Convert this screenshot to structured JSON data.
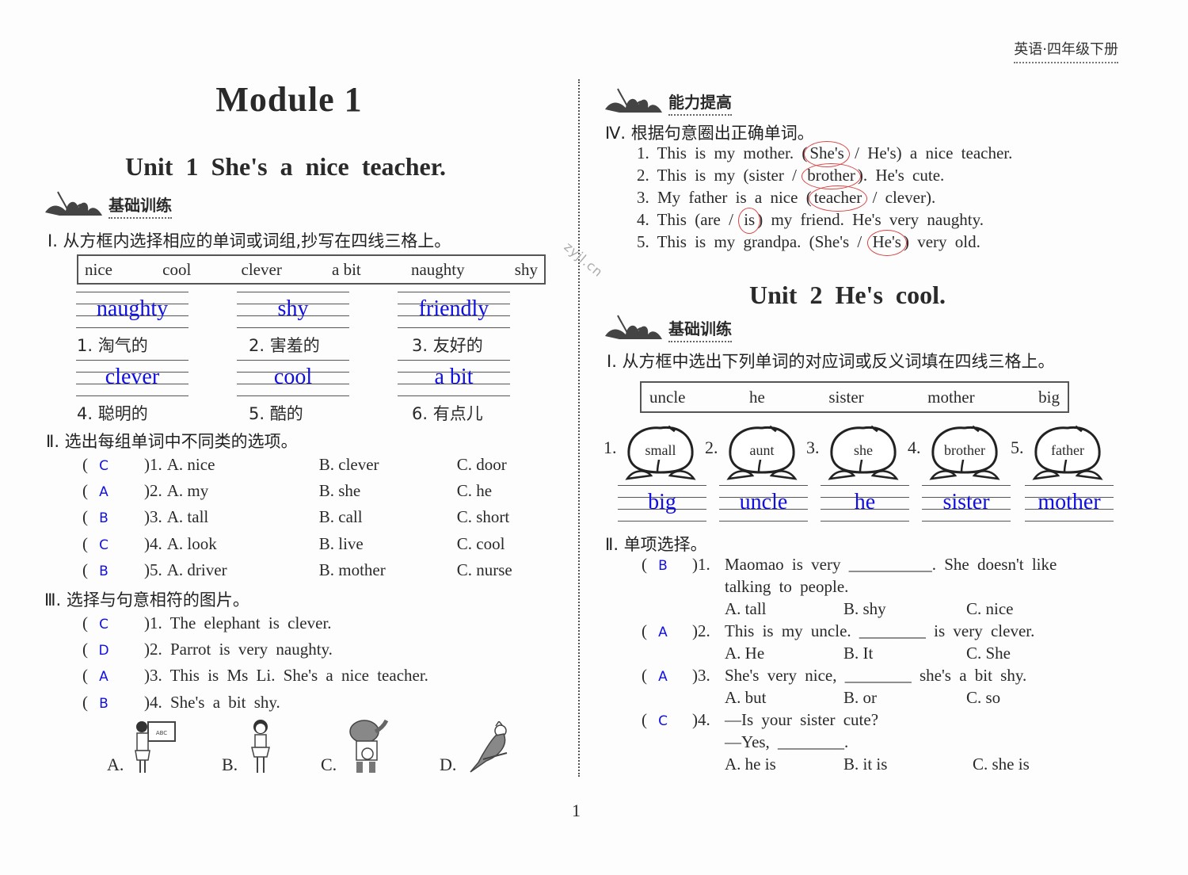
{
  "header": {
    "book_title": "英语·四年级下册",
    "watermark": "zyjl.cn",
    "page_number": "1"
  },
  "left": {
    "module_title": "Module  1",
    "unit_title": "Unit 1   She's a nice teacher.",
    "section_label": "基础训练",
    "q1": {
      "title": "Ⅰ. 从方框内选择相应的单词或词组,抄写在四线三格上。",
      "word_box": [
        "nice",
        "cool",
        "clever",
        "a bit",
        "naughty",
        "shy"
      ],
      "items": [
        {
          "label": "1. 淘气的",
          "answer": "naughty"
        },
        {
          "label": "2. 害羞的",
          "answer": "shy"
        },
        {
          "label": "3. 友好的",
          "answer": "friendly"
        },
        {
          "label": "4. 聪明的",
          "answer": "clever"
        },
        {
          "label": "5. 酷的",
          "answer": "cool"
        },
        {
          "label": "6. 有点儿",
          "answer": "a bit"
        }
      ]
    },
    "q2": {
      "title": "Ⅱ. 选出每组单词中不同类的选项。",
      "items": [
        {
          "answer": "C",
          "num": ")1.",
          "a": "A.  nice",
          "b": "B.  clever",
          "c": "C.  door"
        },
        {
          "answer": "A",
          "num": ")2.",
          "a": "A.  my",
          "b": "B.  she",
          "c": "C.  he"
        },
        {
          "answer": "B",
          "num": ")3.",
          "a": "A.  tall",
          "b": "B.  call",
          "c": "C.  short"
        },
        {
          "answer": "C",
          "num": ")4.",
          "a": "A.  look",
          "b": "B.  live",
          "c": "C.  cool"
        },
        {
          "answer": "B",
          "num": ")5.",
          "a": "A.  driver",
          "b": "B.  mother",
          "c": "C.  nurse"
        }
      ]
    },
    "q3": {
      "title": "Ⅲ. 选择与句意相符的图片。",
      "items": [
        {
          "answer": "C",
          "text": ")1. The elephant is clever."
        },
        {
          "answer": "D",
          "text": ")2. Parrot is very naughty."
        },
        {
          "answer": "A",
          "text": ")3. This is Ms Li. She's a nice teacher."
        },
        {
          "answer": "B",
          "text": ")4. She's a bit shy."
        }
      ],
      "pictures": [
        {
          "label": "A.",
          "icon": "teacher-at-board-icon",
          "board_text": "ABC"
        },
        {
          "label": "B.",
          "icon": "shy-girl-icon"
        },
        {
          "label": "C.",
          "icon": "elephant-icon"
        },
        {
          "label": "D.",
          "icon": "parrot-icon"
        }
      ]
    }
  },
  "right": {
    "section_label": "能力提高",
    "q4": {
      "title": "Ⅳ. 根据句意圈出正确单词。",
      "items": [
        {
          "pre": "1. This is my mother. (",
          "opt1": "She's",
          "sep": " / ",
          "opt2": "He's",
          "post": ") a nice teacher.",
          "circled": "She's"
        },
        {
          "pre": "2. This is my (",
          "opt1": "sister",
          "sep": " / ",
          "opt2": "brother",
          "post": "). He's cute.",
          "circled": "brother"
        },
        {
          "pre": "3. My father is a nice (",
          "opt1": "teacher",
          "sep": " / ",
          "opt2": "clever",
          "post": ").",
          "circled": "teacher"
        },
        {
          "pre": "4. This (",
          "opt1": "are",
          "sep": " / ",
          "opt2": "is",
          "post": ") my friend. He's very naughty.",
          "circled": "is"
        },
        {
          "pre": "5. This is my grandpa. (",
          "opt1": "She's",
          "sep": " / ",
          "opt2": "He's",
          "post": ") very old.",
          "circled": "He's"
        }
      ]
    },
    "unit_title": "Unit 2   He's cool.",
    "section_label2": "基础训练",
    "q1": {
      "title": "Ⅰ. 从方框中选出下列单词的对应词或反义词填在四线三格上。",
      "word_box": [
        "uncle",
        "he",
        "sister",
        "mother",
        "big"
      ],
      "items": [
        {
          "num": "1.",
          "word": "small",
          "answer": "big"
        },
        {
          "num": "2.",
          "word": "aunt",
          "answer": "uncle"
        },
        {
          "num": "3.",
          "word": "she",
          "answer": "he"
        },
        {
          "num": "4.",
          "word": "brother",
          "answer": "sister"
        },
        {
          "num": "5.",
          "word": "father",
          "answer": "mother"
        }
      ]
    },
    "q2": {
      "title": "Ⅱ. 单项选择。",
      "items": [
        {
          "answer": "B",
          "num": ")1.",
          "lines": [
            "Maomao is very __________. She doesn't like",
            "talking to people."
          ],
          "a": "A.  tall",
          "b": "B.  shy",
          "c": "C.  nice"
        },
        {
          "answer": "A",
          "num": ")2.",
          "lines": [
            "This is my uncle. ________ is very clever."
          ],
          "a": "A.  He",
          "b": "B.  It",
          "c": "C.  She"
        },
        {
          "answer": "A",
          "num": ")3.",
          "lines": [
            "She's very nice, ________ she's a bit shy."
          ],
          "a": "A.  but",
          "b": "B.  or",
          "c": "C.  so"
        },
        {
          "answer": "C",
          "num": ")4.",
          "lines": [
            "—Is your sister cute?",
            "—Yes, ________."
          ],
          "a": "A.  he is",
          "b": "B.  it is",
          "c": "C.  she is"
        }
      ]
    }
  },
  "colors": {
    "answer_blue": "#1010e0",
    "circle_red": "#d94545"
  }
}
